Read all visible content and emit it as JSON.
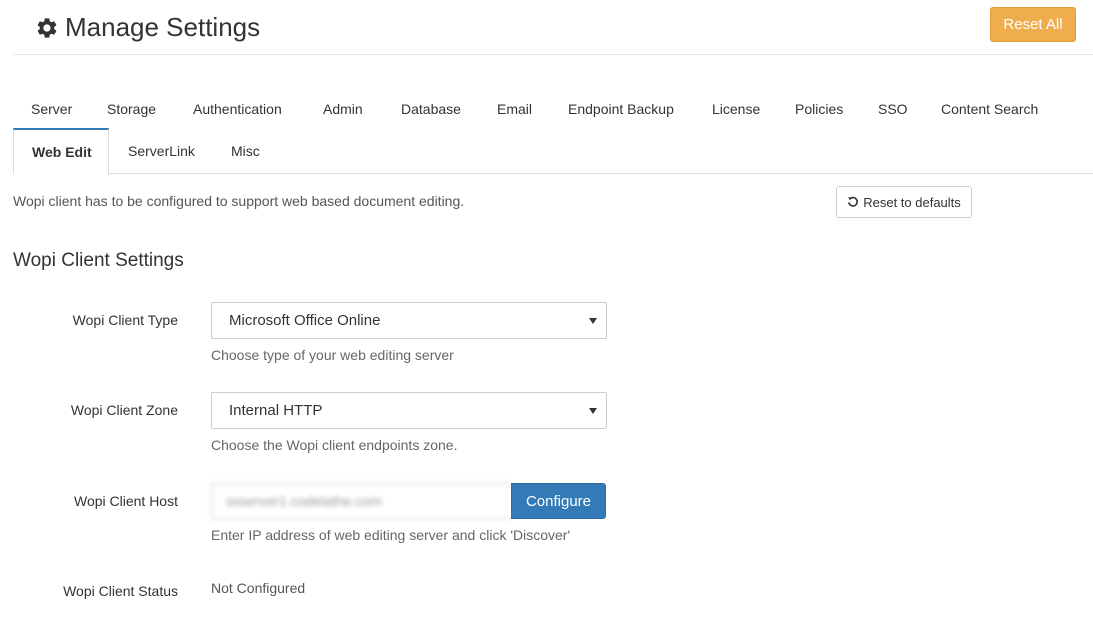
{
  "header": {
    "title": "Manage Settings",
    "title_icon": "gear-icon",
    "reset_all_label": "Reset All"
  },
  "tabs": {
    "row1": [
      {
        "id": "server",
        "label": "Server"
      },
      {
        "id": "storage",
        "label": "Storage"
      },
      {
        "id": "authentication",
        "label": "Authentication"
      },
      {
        "id": "admin",
        "label": "Admin"
      },
      {
        "id": "database",
        "label": "Database"
      },
      {
        "id": "email",
        "label": "Email"
      },
      {
        "id": "endpoint-backup",
        "label": "Endpoint Backup"
      },
      {
        "id": "license",
        "label": "License"
      },
      {
        "id": "policies",
        "label": "Policies"
      },
      {
        "id": "sso",
        "label": "SSO"
      },
      {
        "id": "content-search",
        "label": "Content Search"
      }
    ],
    "row2": [
      {
        "id": "web-edit",
        "label": "Web Edit",
        "active": true
      },
      {
        "id": "serverlink",
        "label": "ServerLink"
      },
      {
        "id": "misc",
        "label": "Misc"
      }
    ]
  },
  "info_text": "Wopi client has to be configured to support web based document editing.",
  "reset_defaults_label": "Reset to defaults",
  "reset_defaults_icon": "undo-icon",
  "section_title": "Wopi Client Settings",
  "fields": {
    "client_type": {
      "label": "Wopi Client Type",
      "value": "Microsoft Office Online",
      "help": "Choose type of your web editing server"
    },
    "client_zone": {
      "label": "Wopi Client Zone",
      "value": "Internal HTTP",
      "help": "Choose the Wopi client endpoints zone."
    },
    "client_host": {
      "label": "Wopi Client Host",
      "value": "ssserver1.codelathe.com",
      "button_label": "Configure",
      "help": "Enter IP address of web editing server and click 'Discover'"
    },
    "client_status": {
      "label": "Wopi Client Status",
      "value": "Not Configured"
    }
  },
  "colors": {
    "warning": "#f0ad4e",
    "primary": "#337ab7",
    "active_tab_border": "#337ab7"
  }
}
